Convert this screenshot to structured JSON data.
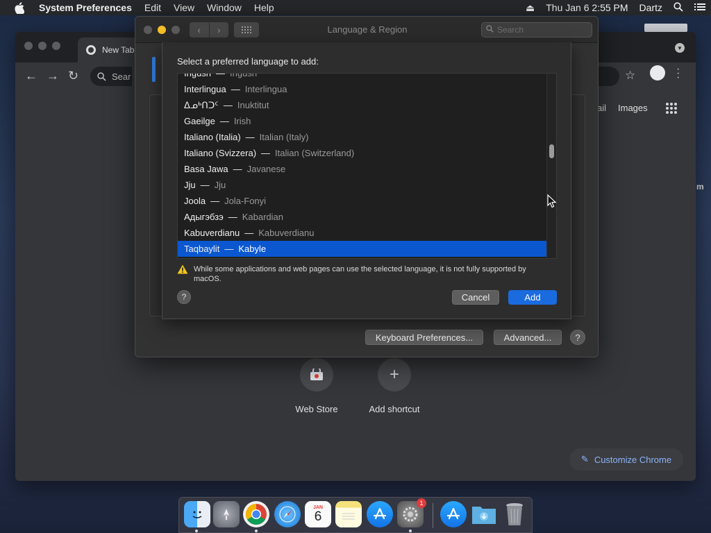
{
  "menubar": {
    "app_name": "System Preferences",
    "menus": [
      "Edit",
      "View",
      "Window",
      "Help"
    ],
    "clock": "Thu Jan 6  2:55 PM",
    "user": "Dartz"
  },
  "desktop": {
    "edge_text": "m"
  },
  "chrome": {
    "tab_title": "New Tab",
    "omnibox_placeholder": "Sear",
    "gmail_fragment": "ail",
    "images_link": "Images",
    "shortcuts": [
      {
        "label": "Web Store",
        "icon": "web-store-icon"
      },
      {
        "label": "Add shortcut",
        "icon": "plus-icon"
      }
    ],
    "customize_label": "Customize Chrome"
  },
  "prefs": {
    "window_title": "Language & Region",
    "search_placeholder": "Search",
    "keyboard_prefs_label": "Keyboard Preferences...",
    "advanced_label": "Advanced...",
    "help_label": "?"
  },
  "sheet": {
    "prompt": "Select a preferred language to add:",
    "separator": "—",
    "languages": [
      {
        "native": "Ingush",
        "english": "Ingush"
      },
      {
        "native": "Interlingua",
        "english": "Interlingua"
      },
      {
        "native": "ᐃᓄᒃᑎᑐᑦ",
        "english": "Inuktitut"
      },
      {
        "native": "Gaeilge",
        "english": "Irish"
      },
      {
        "native": "Italiano (Italia)",
        "english": "Italian (Italy)"
      },
      {
        "native": "Italiano (Svizzera)",
        "english": "Italian (Switzerland)"
      },
      {
        "native": "Basa Jawa",
        "english": "Javanese"
      },
      {
        "native": "Jju",
        "english": "Jju"
      },
      {
        "native": "Joola",
        "english": "Jola-Fonyi"
      },
      {
        "native": "Адыгэбзэ",
        "english": "Kabardian"
      },
      {
        "native": "Kabuverdianu",
        "english": "Kabuverdianu"
      },
      {
        "native": "Taqbaylit",
        "english": "Kabyle"
      }
    ],
    "selected_index": 11,
    "warning_text": "While some applications and web pages can use the selected language, it is not fully supported by macOS.",
    "help_label": "?",
    "cancel_label": "Cancel",
    "add_label": "Add"
  },
  "dock": {
    "apps": [
      {
        "name": "finder-icon",
        "color": "#3d8fe8"
      },
      {
        "name": "launchpad-icon",
        "color": "#8a8f98"
      },
      {
        "name": "chrome-icon",
        "color": "#ffffff"
      },
      {
        "name": "safari-icon",
        "color": "#2b8ef0"
      },
      {
        "name": "calendar-icon",
        "color": "#ffffff"
      },
      {
        "name": "notes-icon",
        "color": "#f6e27a"
      },
      {
        "name": "app-store-icon",
        "color": "#1d8ff0"
      },
      {
        "name": "system-preferences-icon",
        "color": "#6e6e6e"
      },
      {
        "name": "app-store-folder-icon",
        "color": "#1d8ff0"
      },
      {
        "name": "downloads-folder-icon",
        "color": "#6fb7e6"
      },
      {
        "name": "trash-icon",
        "color": "#8d9097"
      }
    ],
    "calendar_month": "JAN",
    "calendar_day": "6",
    "sysprefs_badge": "1"
  }
}
